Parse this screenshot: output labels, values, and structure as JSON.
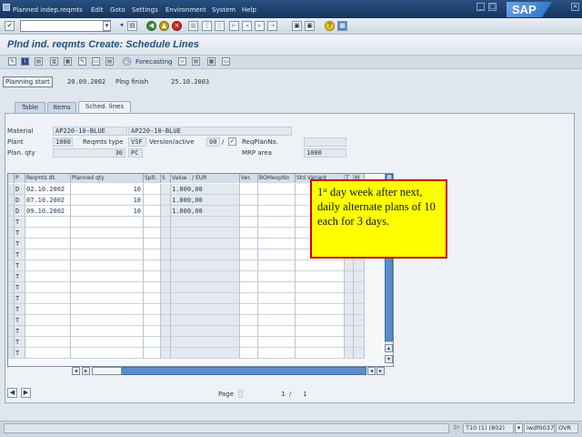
{
  "menu": {
    "items": [
      "Planned indep.reqmts",
      "Edit",
      "Goto",
      "Settings",
      "Environment",
      "System",
      "Help"
    ]
  },
  "logo": {
    "text": "SAP"
  },
  "title": "Plnd ind. reqmts Create: Schedule Lines",
  "app_toolbar": {
    "forecasting_label": "Forecasting"
  },
  "header": {
    "planning_start_label": "Planning start",
    "planning_start_value": "20.09.2002",
    "planning_finish_label": "Plng finish",
    "planning_finish_value": "25.10.2003"
  },
  "tabs": [
    {
      "label": "Table",
      "active": false
    },
    {
      "label": "Items",
      "active": false
    },
    {
      "label": "Sched. lines",
      "active": true
    }
  ],
  "sched": {
    "material_label": "Material",
    "material_value": "AP220-10-BLUE",
    "material_desc": "AP220-10-BLUE",
    "plant_label": "Plant",
    "plant_value": "1000",
    "reqmts_type_label": "Reqmts type",
    "reqmts_type_value": "VSF",
    "version_label": "Version/active",
    "version_value": "00",
    "version_sep": "/",
    "req_plan_no_label": "ReqPlanNo.",
    "plan_qty_label": "Plan. qty",
    "plan_qty_value": "30",
    "unit_value": "PC",
    "mrp_area_label": "MRP area",
    "mrp_area_value": "1000"
  },
  "table": {
    "columns": [
      "P",
      "Reqmts dt.",
      "Planned qty",
      "Splt.",
      "S",
      "Value . / EUR",
      "Ver.",
      "BOMexpNo",
      "Std.Variant",
      "T",
      "M"
    ],
    "rows": [
      {
        "p": "D",
        "date": "02.10.2002",
        "qty": "10",
        "value": "1.000,00"
      },
      {
        "p": "D",
        "date": "07.10.2002",
        "qty": "10",
        "value": "1.000,00"
      },
      {
        "p": "D",
        "date": "09.10.2002",
        "qty": "10",
        "value": "1.000,00"
      },
      {
        "p": "T",
        "date": "",
        "qty": "",
        "value": ""
      },
      {
        "p": "T",
        "date": "",
        "qty": "",
        "value": ""
      },
      {
        "p": "T",
        "date": "",
        "qty": "",
        "value": ""
      },
      {
        "p": "T",
        "date": "",
        "qty": "",
        "value": ""
      },
      {
        "p": "T",
        "date": "",
        "qty": "",
        "value": ""
      },
      {
        "p": "T",
        "date": "",
        "qty": "",
        "value": ""
      },
      {
        "p": "T",
        "date": "",
        "qty": "",
        "value": ""
      },
      {
        "p": "T",
        "date": "",
        "qty": "",
        "value": ""
      },
      {
        "p": "T",
        "date": "",
        "qty": "",
        "value": ""
      },
      {
        "p": "T",
        "date": "",
        "qty": "",
        "value": ""
      },
      {
        "p": "T",
        "date": "",
        "qty": "",
        "value": ""
      },
      {
        "p": "T",
        "date": "",
        "qty": "",
        "value": ""
      },
      {
        "p": "T",
        "date": "",
        "qty": "",
        "value": ""
      }
    ]
  },
  "callout": {
    "superscript_prefix": "1",
    "superscript": "st",
    "text": " day week after next, daily alternate plans of 10 each for 3 days."
  },
  "pager": {
    "label": "Page",
    "current": "1",
    "sep": "/",
    "total": "1"
  },
  "status": {
    "system": "T10 (1) (802)",
    "server": "iwdf0037",
    "mode": "OVR"
  }
}
